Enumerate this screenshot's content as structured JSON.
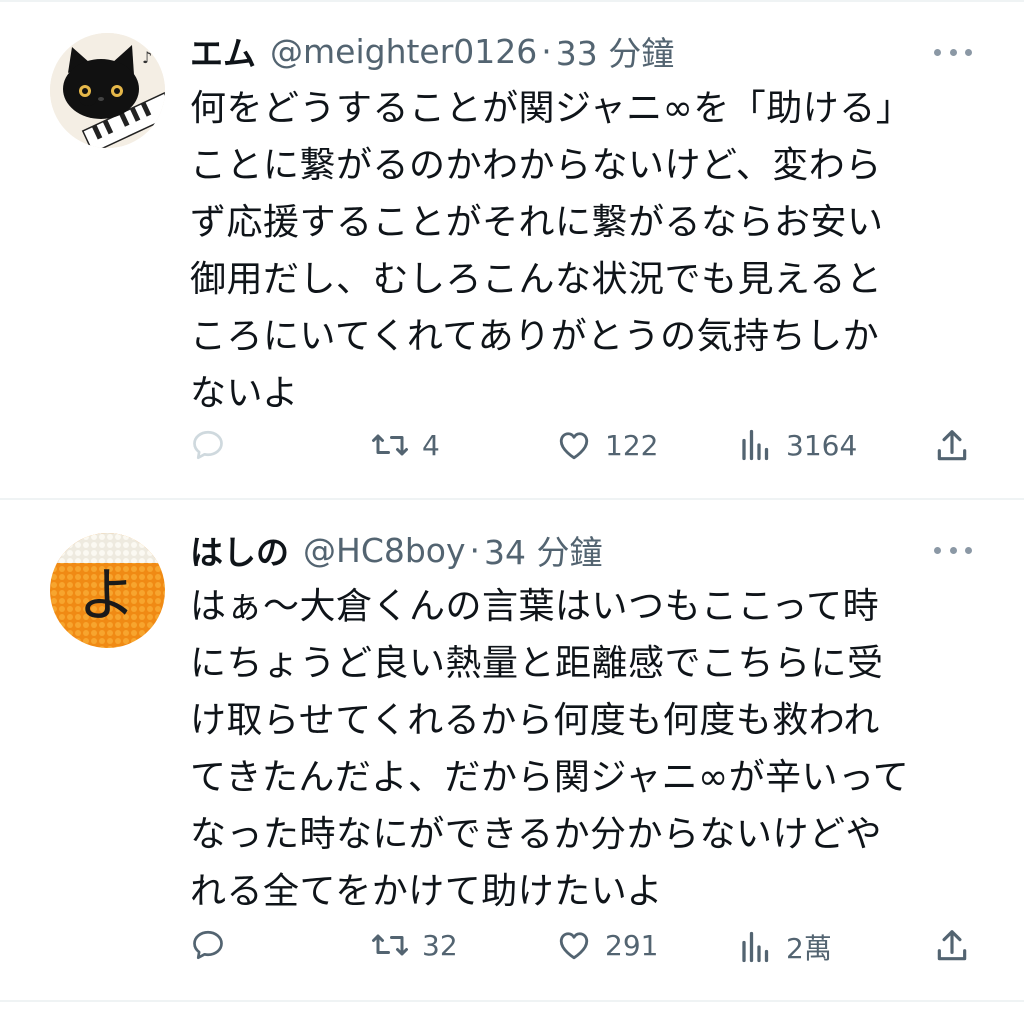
{
  "tweets": [
    {
      "name": "エム",
      "handle": "@meighter0126",
      "separator": "·",
      "time": "33 分鐘",
      "text": "何をどうすることが関ジャニ∞を「助ける」\nことに繋がるのかわからないけど、変わら\nず応援することがそれに繋がるならお安い\n御用だし、むしろこんな状況でも見えると\nころにいてくれてありがとうの気持ちしか\nないよ",
      "counts": {
        "reply": "",
        "retweet": "4",
        "like": "122",
        "views": "3164"
      },
      "reply_icon_color": "#cfd9de"
    },
    {
      "name": "はしの",
      "handle": "@HC8boy",
      "separator": "·",
      "time": "34 分鐘",
      "text": "はぁ〜大倉くんの言葉はいつもここって時\nにちょうど良い熱量と距離感でこちらに受\nけ取らせてくれるから何度も何度も救われ\nてきたんだよ、だから関ジャニ∞が辛いって\nなった時なにができるか分からないけどや\nれる全てをかけて助けたいよ",
      "counts": {
        "reply": "",
        "retweet": "32",
        "like": "291",
        "views": "2萬"
      },
      "avatar_glyph": "よ",
      "reply_icon_color": "#536471"
    }
  ],
  "colors": {
    "text": "#0f1419",
    "secondary": "#536471",
    "divider": "#eff3f4",
    "avatar2_orange": "#f2951f"
  }
}
